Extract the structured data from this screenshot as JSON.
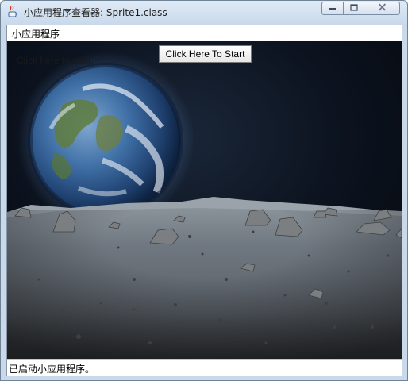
{
  "window": {
    "title": "小应用程序查看器: Sprite1.class",
    "controls": {
      "minimize": "—",
      "maximize": "▢",
      "close": "✕"
    }
  },
  "menu": {
    "items": [
      "小应用程序"
    ]
  },
  "applet": {
    "hint_text": "Click here to start.",
    "start_button_label": "Click Here To Start",
    "scene": "earth-rising-over-moon-surface",
    "colors": {
      "space": "#0a0f18",
      "earth_ocean": "#2f5c8e",
      "moon_ground": "#6c727a"
    }
  },
  "status": {
    "text": "已启动小应用程序。"
  },
  "icons": {
    "app_icon": "java-coffee-cup-icon"
  }
}
